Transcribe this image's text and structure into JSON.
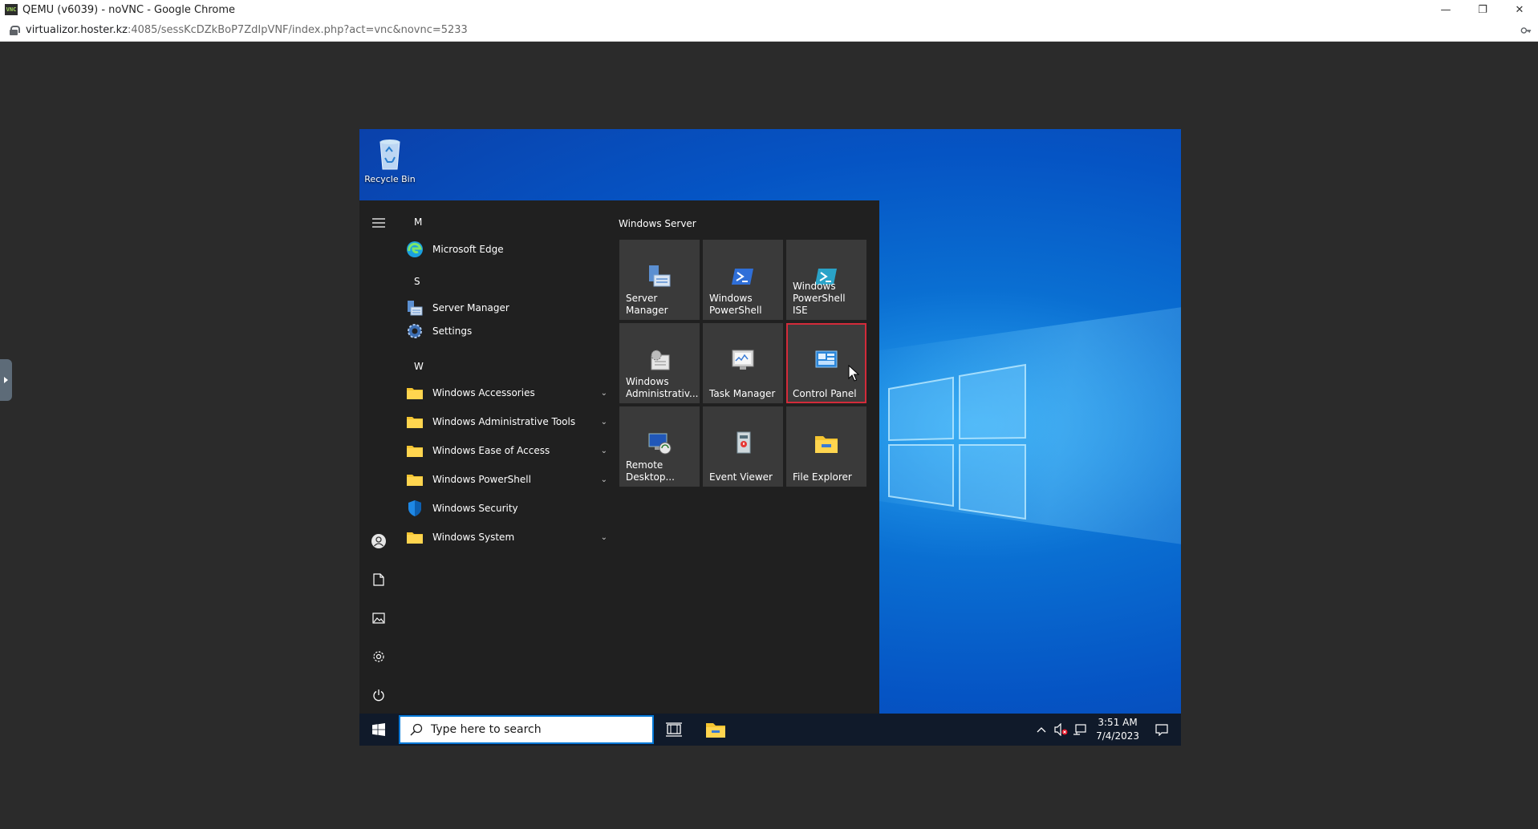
{
  "browser": {
    "title": "QEMU (v6039) - noVNC - Google Chrome",
    "logo_text": "VNC",
    "url_host": "virtualizor.hoster.kz",
    "url_path": ":4085/sessKcDZkBoP7ZdIpVNF/index.php?act=vnc&novnc=5233"
  },
  "desktop": {
    "recycle_bin_label": "Recycle Bin"
  },
  "start_menu": {
    "sections": [
      {
        "letter": "M",
        "items": [
          {
            "label": "Microsoft Edge",
            "icon": "edge-icon"
          }
        ]
      },
      {
        "letter": "S",
        "items": [
          {
            "label": "Server Manager",
            "icon": "server-manager-icon"
          },
          {
            "label": "Settings",
            "icon": "settings-icon"
          }
        ]
      },
      {
        "letter": "W",
        "items": [
          {
            "label": "Windows Accessories",
            "icon": "folder-icon",
            "expandable": true
          },
          {
            "label": "Windows Administrative Tools",
            "icon": "folder-icon",
            "expandable": true
          },
          {
            "label": "Windows Ease of Access",
            "icon": "folder-icon",
            "expandable": true
          },
          {
            "label": "Windows PowerShell",
            "icon": "folder-icon",
            "expandable": true
          },
          {
            "label": "Windows Security",
            "icon": "shield-icon",
            "expandable": false
          },
          {
            "label": "Windows System",
            "icon": "folder-icon",
            "expandable": true
          }
        ]
      }
    ],
    "tiles_group_title": "Windows Server",
    "tiles": [
      {
        "label": "Server Manager",
        "icon": "server-manager-icon"
      },
      {
        "label": "Windows PowerShell",
        "icon": "powershell-icon"
      },
      {
        "label": "Windows PowerShell ISE",
        "icon": "powershell-ise-icon"
      },
      {
        "label": "Windows Administrativ...",
        "icon": "admin-tools-icon"
      },
      {
        "label": "Task Manager",
        "icon": "task-manager-icon"
      },
      {
        "label": "Control Panel",
        "icon": "control-panel-icon",
        "selected": true
      },
      {
        "label": "Remote Desktop...",
        "icon": "remote-desktop-icon"
      },
      {
        "label": "Event Viewer",
        "icon": "event-viewer-icon"
      },
      {
        "label": "File Explorer",
        "icon": "file-explorer-icon"
      }
    ]
  },
  "taskbar": {
    "search_placeholder": "Type here to search",
    "time": "3:51 AM",
    "date": "7/4/2023"
  },
  "colors": {
    "accent": "#0078d7",
    "selection_outline": "#d32b3a",
    "start_bg": "#202020",
    "tile_bg": "#3a3a3a"
  }
}
